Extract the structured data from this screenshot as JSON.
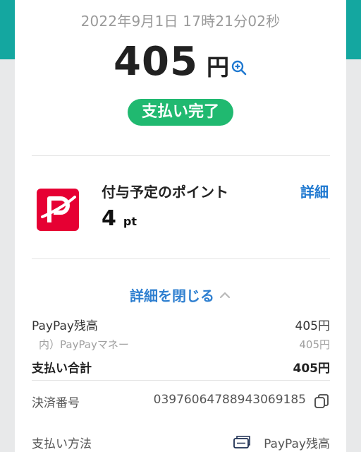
{
  "transaction": {
    "datetime": "2022年9月1日 17時21分02秒",
    "amount": "405",
    "currency": "円",
    "status_badge": "支払い完了"
  },
  "points": {
    "title": "付与予定のポイント",
    "details_link": "詳細",
    "value": "4",
    "unit": "pt"
  },
  "breakdown": {
    "toggle_label": "詳細を閉じる",
    "paypay_balance_label": "PayPay残高",
    "paypay_balance_value": "405円",
    "money_label": "内）PayPayマネー",
    "money_value": "405円",
    "total_label": "支払い合計",
    "total_value": "405円"
  },
  "info": {
    "payment_number_label": "決済番号",
    "payment_number_value": "03976064788943069185",
    "payment_method_label": "支払い方法",
    "payment_method_value": "PayPay残高"
  },
  "colors": {
    "teal_header": "#14a7a0",
    "status_green": "#20b970",
    "link_blue": "#1e78d0",
    "paypay_red": "#e60033"
  },
  "icons": {
    "zoom": "magnifier-plus-icon",
    "chevron": "chevron-up-icon",
    "copy": "copy-icon",
    "payment_method": "card-icon",
    "logo": "paypay-logo-icon"
  }
}
